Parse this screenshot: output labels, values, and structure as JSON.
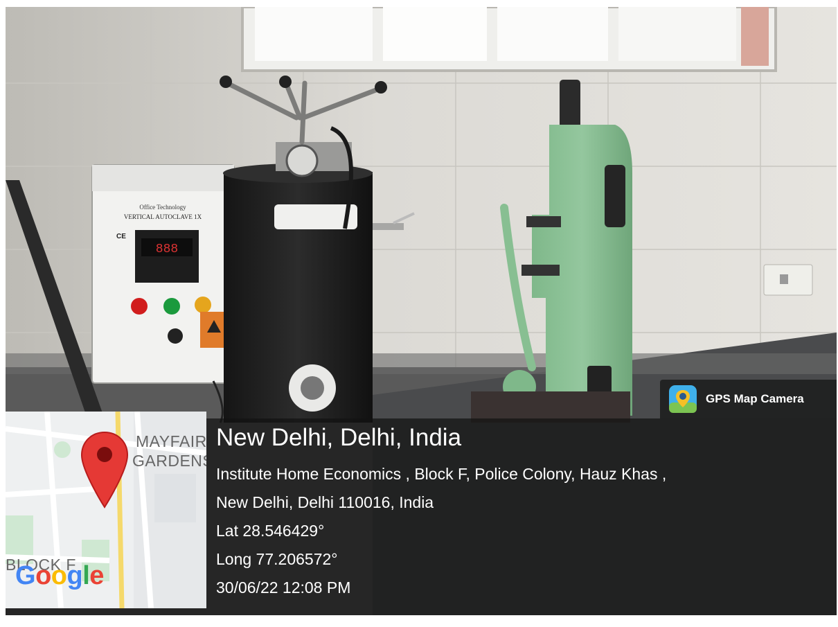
{
  "overlay": {
    "app_name": "GPS Map Camera",
    "city": "New Delhi, Delhi, India",
    "address_line1": "Institute Home Economics , Block F, Police Colony, Hauz Khas ,",
    "address_line2": "New Delhi, Delhi 110016, India",
    "latitude": "Lat 28.546429°",
    "longitude": "Long 77.206572°",
    "timestamp": "30/06/22 12:08 PM"
  },
  "map": {
    "label_area1": "MAYFAIR",
    "label_area2": "GARDENS",
    "label_block": "BLOCK F",
    "logo_letters": [
      "G",
      "o",
      "o",
      "g",
      "l",
      "e"
    ],
    "logo_colors": [
      "#4285F4",
      "#EA4335",
      "#FBBC05",
      "#4285F4",
      "#34A853",
      "#EA4335"
    ],
    "pin_color": "#e53935"
  },
  "photo": {
    "panel_brand": "Office Technology",
    "panel_title": "VERTICAL AUTOCLAVE 1X",
    "panel_mark": "CE",
    "display": "888"
  }
}
